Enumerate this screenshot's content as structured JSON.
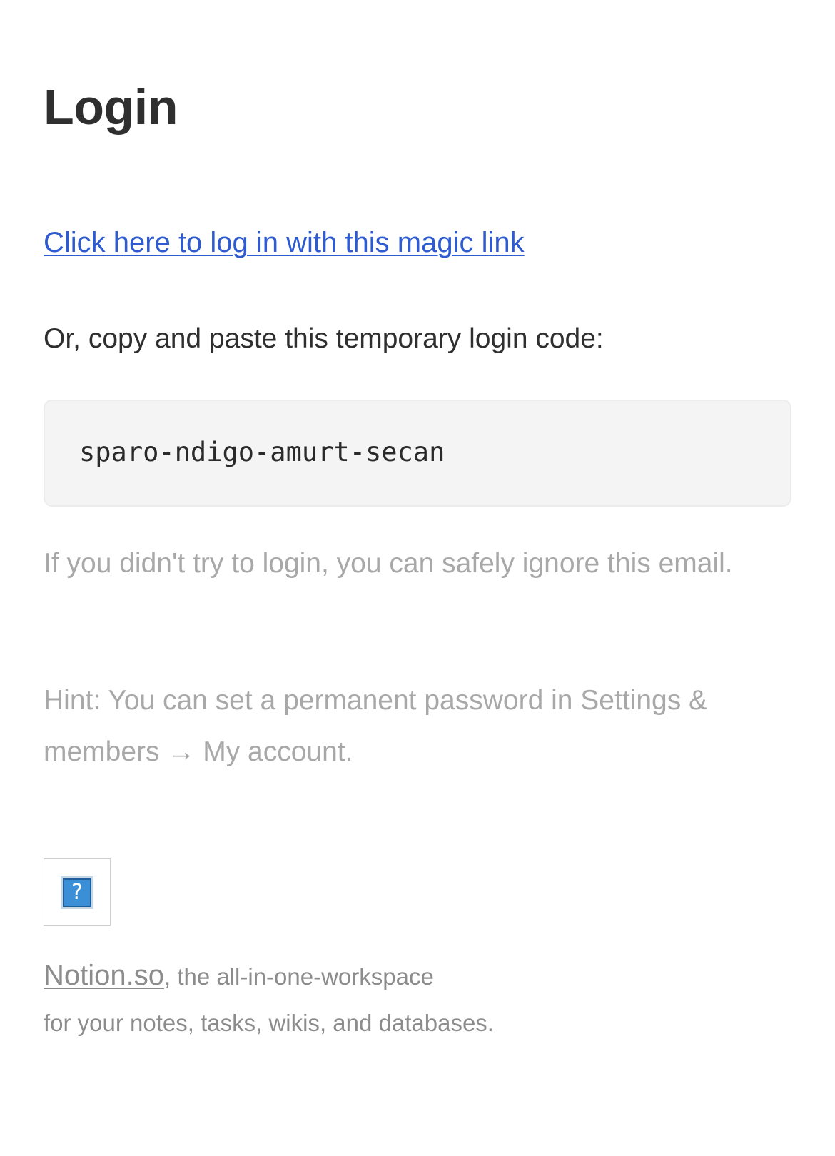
{
  "email": {
    "title": "Login",
    "magic_link_text": "Click here to log in with this magic link",
    "code_intro": "Or, copy and paste this temporary login code:",
    "login_code": "sparo-ndigo-amurt-secan",
    "ignore_note": "If you didn't try to login, you can safely ignore this email.",
    "hint_note": "Hint: You can set a permanent password in Settings & members → My account.",
    "logo": {
      "icon": "broken-image-icon",
      "glyph": "?"
    },
    "footer": {
      "link_text": "Notion.so",
      "line1_rest": ", the all-in-one-workspace",
      "line2": "for your notes, tasks, wikis, and databases."
    }
  },
  "colors": {
    "link": "#2f5bd0",
    "text": "#2f2f2f",
    "muted": "#a8a8a8",
    "footer": "#8c8c8c",
    "code_background": "#f4f4f4"
  }
}
